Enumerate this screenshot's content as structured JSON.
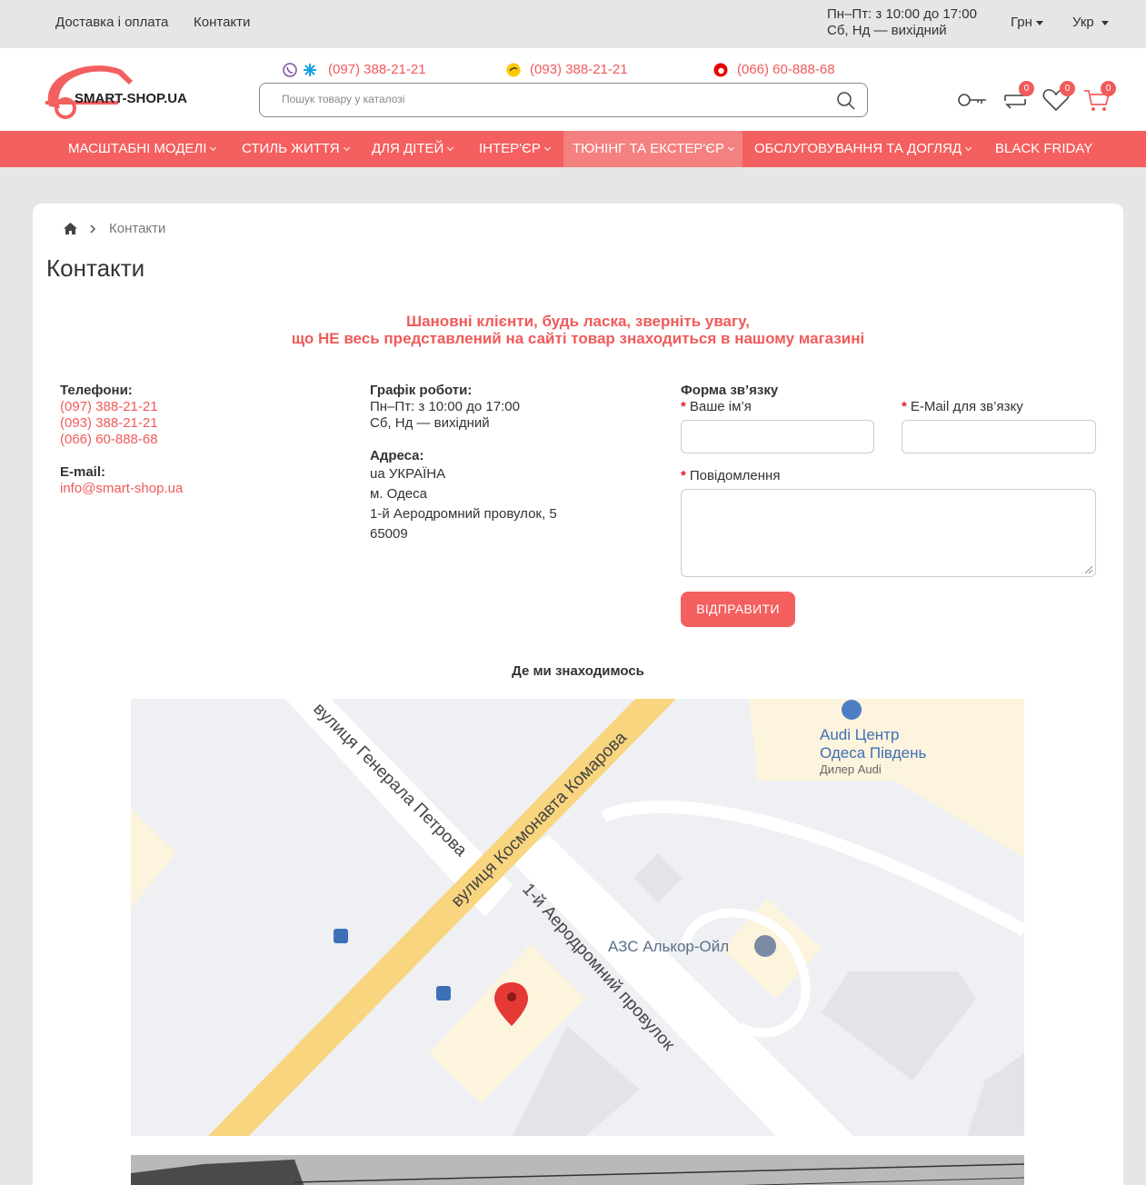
{
  "topbar": {
    "links": [
      "Доставка і оплата",
      "Контакти"
    ],
    "hours_line1": "Пн–Пт: з 10:00 до 17:00",
    "hours_line2": "Сб, Нд — вихідний",
    "currency": "Грн",
    "language": "Укр"
  },
  "header": {
    "logo_text": "SMART-SHOP.UA",
    "phones": [
      "(097) 388-21-21",
      "(093) 388-21-21",
      "(066) 60-888-68"
    ],
    "search_placeholder": "Пошук товару у каталозі",
    "compare_count": "0",
    "wishlist_count": "0",
    "cart_count": "0"
  },
  "nav": {
    "items": [
      "МАСШТАБНІ МОДЕЛІ",
      "СТИЛЬ ЖИТТЯ",
      "ДЛЯ ДІТЕЙ",
      "ІНТЕР'ЄР",
      "ТЮНІНГ ТА ЕКСТЕР'ЄР",
      "ОБСЛУГОВУВАННЯ ТА ДОГЛЯД",
      "BLACK FRIDAY"
    ]
  },
  "breadcrumb": {
    "current": "Контакти"
  },
  "page": {
    "title": "Контакти",
    "notice_line1": "Шановні клієнти, будь ласка, зверніть увагу,",
    "notice_line2": "що НЕ весь представлений на сайті товар знаходиться в нашому магазині"
  },
  "contacts": {
    "phones_label": "Телефони:",
    "phones": [
      "(097) 388-21-21",
      "(093) 388-21-21",
      "(066) 60-888-68"
    ],
    "email_label": "E-mail:",
    "email": "info@smart-shop.ua",
    "schedule_label": "Графік роботи:",
    "schedule_line1": "Пн–Пт: з 10:00 до 17:00",
    "schedule_line2": "Сб, Нд — вихідний",
    "address_label": "Адреса:",
    "address_lines": [
      "ua УКРАЇНА",
      "м. Одеса",
      "1-й Аеродромний провулок, 5",
      "65009"
    ]
  },
  "form": {
    "title": "Форма зв’язку",
    "name_label": "Ваше ім’я",
    "email_label": "E-Mail для зв’язку",
    "message_label": "Повідомлення",
    "submit_label": "ВІДПРАВИТИ"
  },
  "map": {
    "heading": "Де ми знаходимось",
    "street1": "вулиця Генерала Петрова",
    "street2": "вулиця Космонавта Комарова",
    "street3": "1-й Аеродромний провулок",
    "poi1_name1": "Audi Центр",
    "poi1_name2": "Одеса Південь",
    "poi1_sub": "Дилер Audi",
    "poi2_name": "АЗС Алькор-Ойл"
  },
  "colors": {
    "accent": "#f45f5f",
    "text": "#333333",
    "background": "#e6e6e6"
  }
}
